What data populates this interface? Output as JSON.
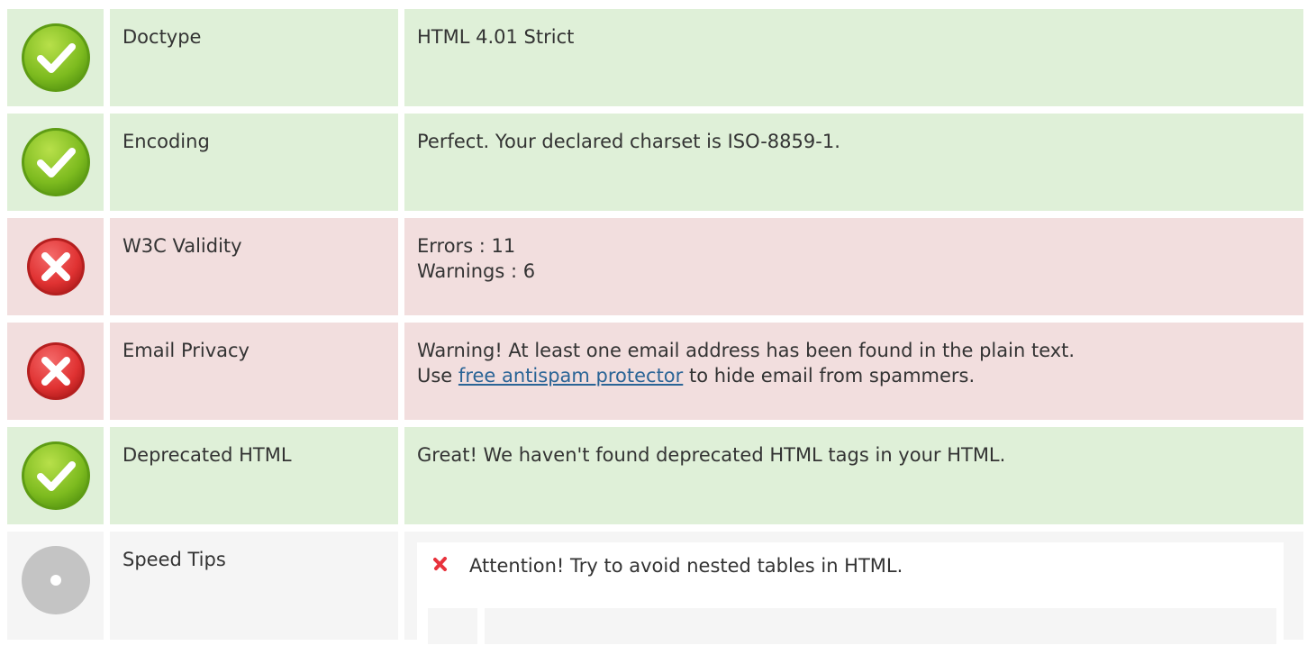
{
  "rows": [
    {
      "status": "ok",
      "label": "Doctype",
      "lines": [
        "HTML 4.01 Strict"
      ]
    },
    {
      "status": "ok",
      "label": "Encoding",
      "lines": [
        "Perfect. Your declared charset is ISO-8859-1."
      ]
    },
    {
      "status": "bad",
      "label": "W3C Validity",
      "lines": [
        "Errors : 11",
        "Warnings : 6"
      ]
    },
    {
      "status": "bad",
      "label": "Email Privacy",
      "line1": "Warning! At least one email address has been found in the plain text.",
      "line2_prefix": "Use ",
      "link_text": "free antispam protector",
      "line2_suffix": " to hide email from spammers."
    },
    {
      "status": "ok",
      "label": "Deprecated HTML",
      "lines": [
        "Great! We haven't found deprecated HTML tags in your HTML."
      ]
    },
    {
      "status": "neutral",
      "label": "Speed Tips",
      "tip": "Attention! Try to avoid nested tables in HTML."
    }
  ],
  "colors": {
    "ok_bg": "#dff0d8",
    "bad_bg": "#f2dede",
    "neutral_bg": "#f5f5f5",
    "link": "#2a6496",
    "tip_x": "#e8323c"
  },
  "icons": {
    "ok": "check-circle-icon",
    "bad": "x-circle-icon",
    "neutral": "gray-dot-icon",
    "tip": "x-mark-icon"
  }
}
